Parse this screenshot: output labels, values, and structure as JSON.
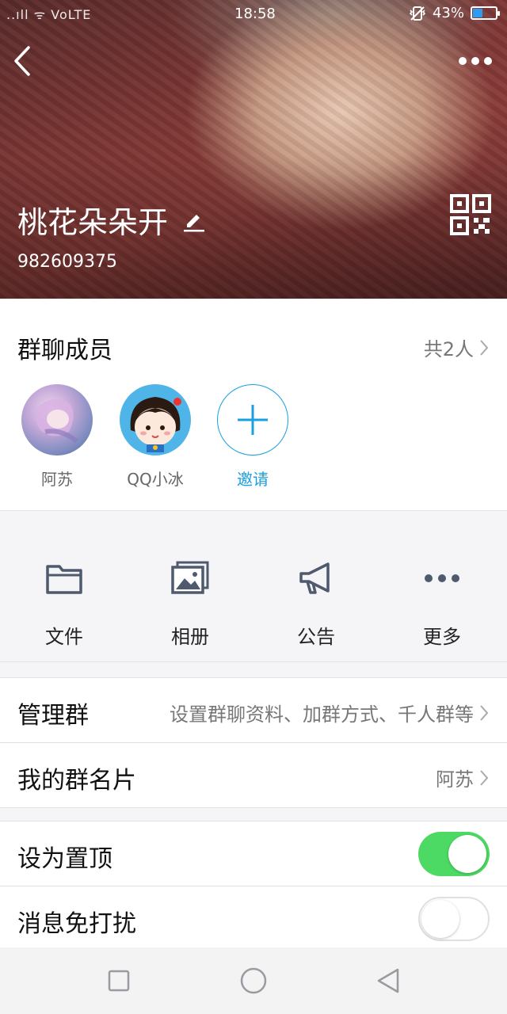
{
  "status_bar": {
    "left": "..ıll ᯤ VoLTE",
    "time": "18:58",
    "battery": "43%"
  },
  "header": {
    "group_name": "桃花朵朵开",
    "group_id": "982609375"
  },
  "members": {
    "title": "群聊成员",
    "count": "共2人",
    "items": [
      {
        "label": "阿苏"
      },
      {
        "label": "QQ小冰"
      }
    ],
    "invite_label": "邀请"
  },
  "shortcuts": [
    {
      "label": "文件",
      "icon": "folder-icon"
    },
    {
      "label": "相册",
      "icon": "album-icon"
    },
    {
      "label": "公告",
      "icon": "megaphone-icon"
    },
    {
      "label": "更多",
      "icon": "more-dots-icon"
    }
  ],
  "settings": {
    "manage": {
      "title": "管理群",
      "value": "设置群聊资料、加群方式、千人群等"
    },
    "card": {
      "title": "我的群名片",
      "value": "阿苏"
    },
    "pin": {
      "title": "设为置顶",
      "on": true
    },
    "mute": {
      "title": "消息免打扰",
      "on": false
    }
  },
  "colors": {
    "accent": "#1aa0e0",
    "toggle_on": "#4cd964",
    "battery_fill": "#2e9bf0"
  }
}
